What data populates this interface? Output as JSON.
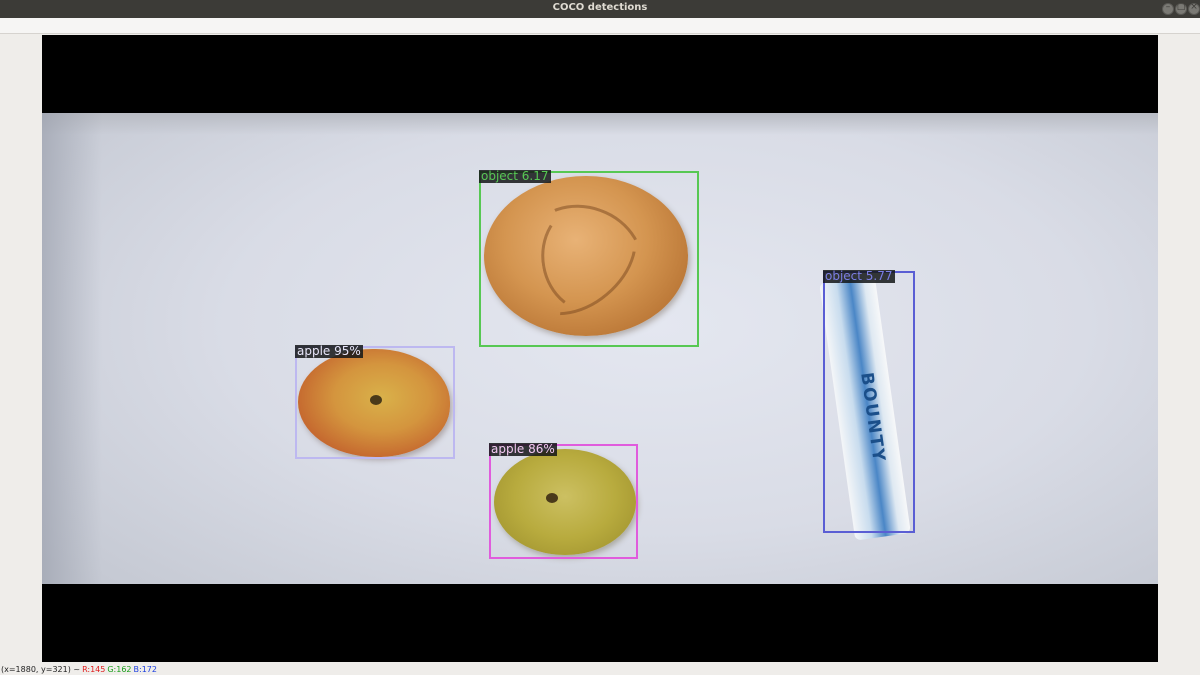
{
  "window": {
    "title": "COCO detections"
  },
  "detections": [
    {
      "label": "object 6.17",
      "color": "#57c853"
    },
    {
      "label": "object 5.77",
      "color": "#5a5ed4"
    },
    {
      "label": "apple 95%",
      "color": "#bdb8f0"
    },
    {
      "label": "apple 86%",
      "color": "#e05cdd"
    }
  ],
  "image_content": {
    "bar_wrapper_text": "BOUNTY"
  },
  "status": {
    "coords": "(x=1880, y=321) ~",
    "r": "R:145",
    "g": "G:162",
    "b": "B:172",
    "r_color": "#e01b1b",
    "g_color": "#1b9e1b",
    "b_color": "#1b3fe0"
  }
}
